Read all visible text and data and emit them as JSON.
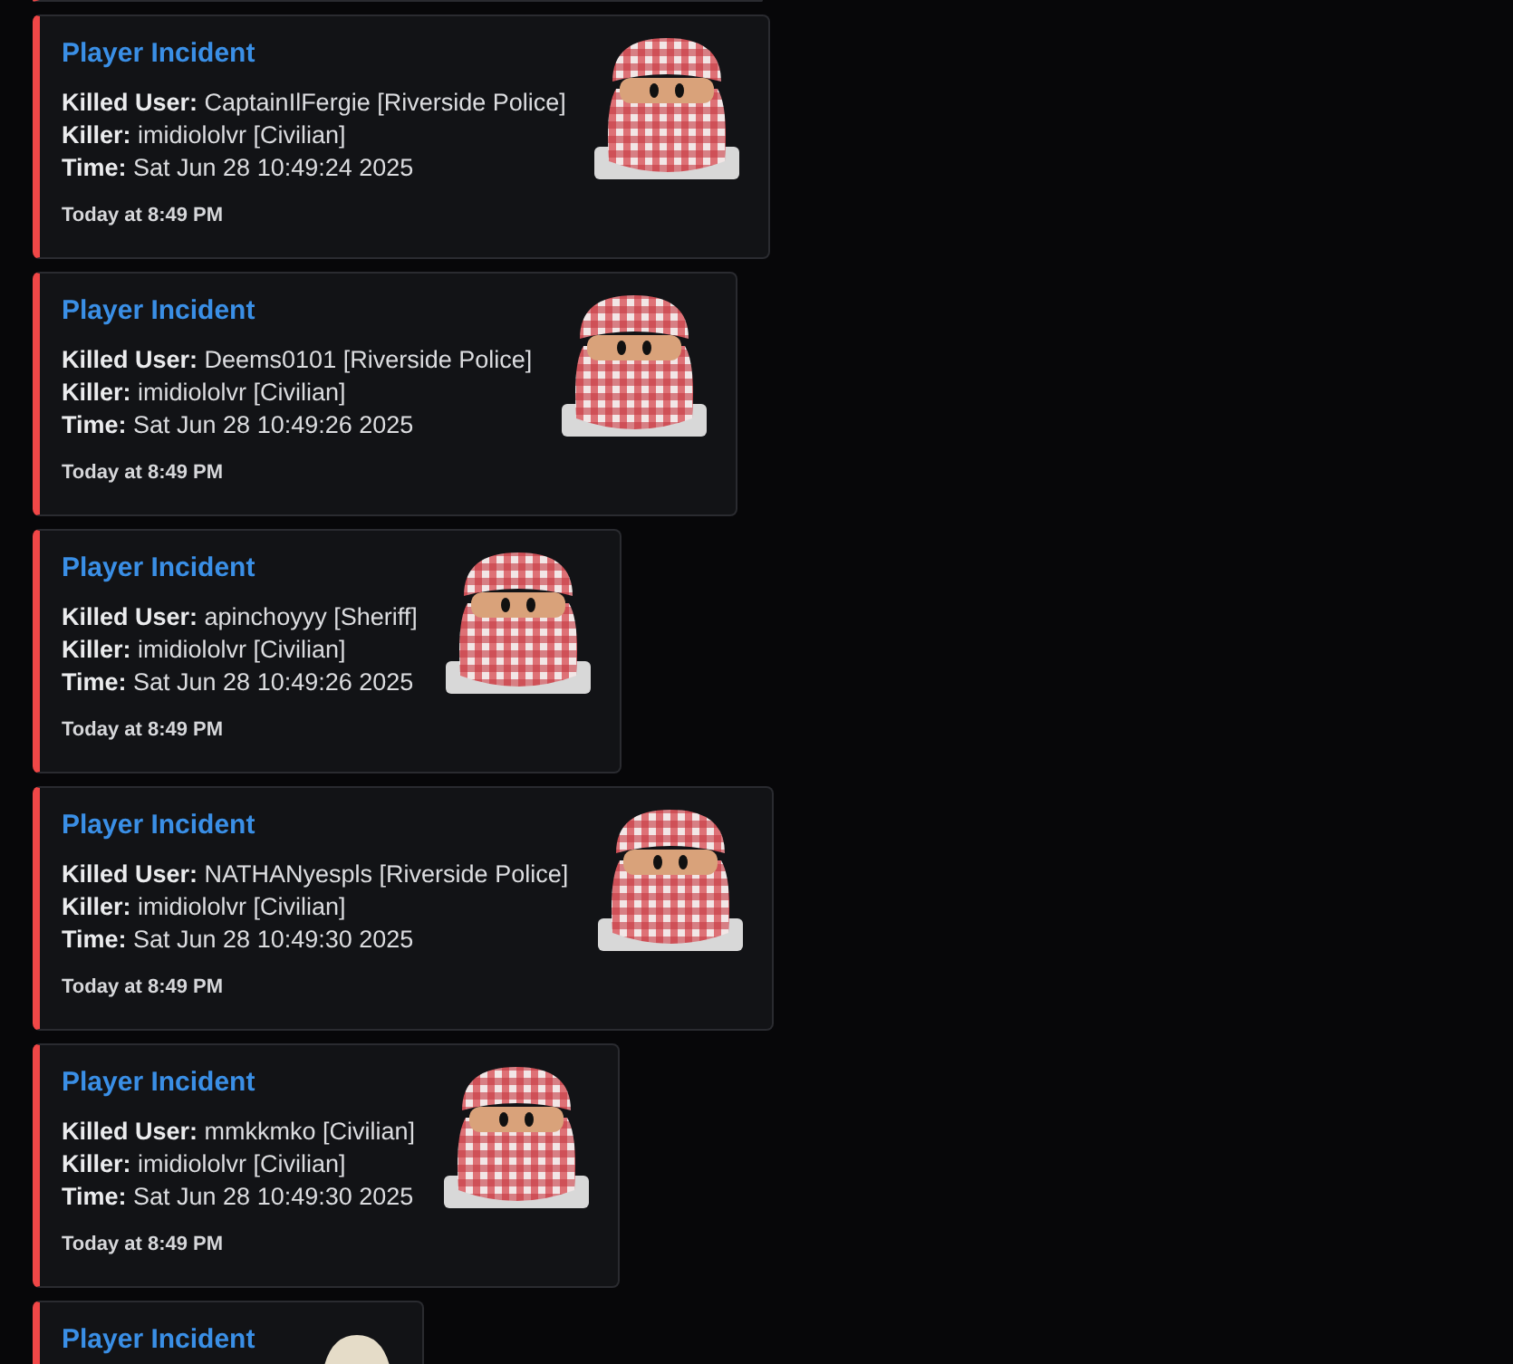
{
  "embeds": [
    {
      "title": "Player Incident",
      "fields": [
        {
          "name": "Killed User:",
          "value": "CaptainIlFergie [Riverside Police]"
        },
        {
          "name": "Killer:",
          "value": "imidiololvr [Civilian]"
        },
        {
          "name": "Time:",
          "value": "Sat Jun 28 10:49:24 2025"
        }
      ],
      "footer": "Today at 8:49 PM",
      "thumbnail": {
        "kind": "plaid"
      }
    },
    {
      "title": "Player Incident",
      "fields": [
        {
          "name": "Killed User:",
          "value": "Deems0101 [Riverside Police]"
        },
        {
          "name": "Killer:",
          "value": "imidiololvr [Civilian]"
        },
        {
          "name": "Time:",
          "value": "Sat Jun 28 10:49:26 2025"
        }
      ],
      "footer": "Today at 8:49 PM",
      "thumbnail": {
        "kind": "plaid"
      }
    },
    {
      "title": "Player Incident",
      "fields": [
        {
          "name": "Killed User:",
          "value": "apinchoyyy [Sheriff]"
        },
        {
          "name": "Killer:",
          "value": "imidiololvr [Civilian]"
        },
        {
          "name": "Time:",
          "value": "Sat Jun 28 10:49:26 2025"
        }
      ],
      "footer": "Today at 8:49 PM",
      "thumbnail": {
        "kind": "plaid"
      }
    },
    {
      "title": "Player Incident",
      "fields": [
        {
          "name": "Killed User:",
          "value": "NATHANyespls [Riverside Police]"
        },
        {
          "name": "Killer:",
          "value": "imidiololvr [Civilian]"
        },
        {
          "name": "Time:",
          "value": "Sat Jun 28 10:49:30 2025"
        }
      ],
      "footer": "Today at 8:49 PM",
      "thumbnail": {
        "kind": "plaid"
      }
    },
    {
      "title": "Player Incident",
      "fields": [
        {
          "name": "Killed User:",
          "value": "mmkkmko [Civilian]"
        },
        {
          "name": "Killer:",
          "value": "imidiololvr [Civilian]"
        },
        {
          "name": "Time:",
          "value": "Sat Jun 28 10:49:30 2025"
        }
      ],
      "footer": "Today at 8:49 PM",
      "thumbnail": {
        "kind": "plaid"
      }
    },
    {
      "title": "Player Incident",
      "thumbnail": {
        "kind": "beige"
      }
    }
  ]
}
